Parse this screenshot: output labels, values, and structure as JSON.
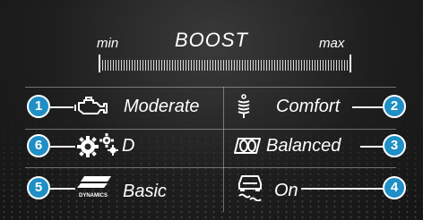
{
  "boost": {
    "title": "BOOST",
    "min_label": "min",
    "max_label": "max",
    "level_fraction": 1.0
  },
  "settings": [
    {
      "id": 1,
      "label": "Moderate",
      "icon": "engine-icon"
    },
    {
      "id": 2,
      "label": "Comfort",
      "icon": "suspension-spring-icon"
    },
    {
      "id": 3,
      "label": "Balanced",
      "icon": "steering-balance-icon"
    },
    {
      "id": 4,
      "label": "On",
      "icon": "esp-skid-icon"
    },
    {
      "id": 5,
      "label": "Basic",
      "icon": "amg-dynamics-icon",
      "icon_text": "DYNAMICS"
    },
    {
      "id": 6,
      "label": "D",
      "icon": "transmission-gear-icon"
    }
  ],
  "colors": {
    "badge": "#1f8fc6",
    "text": "#ffffff",
    "background": "#1e1e1e"
  }
}
